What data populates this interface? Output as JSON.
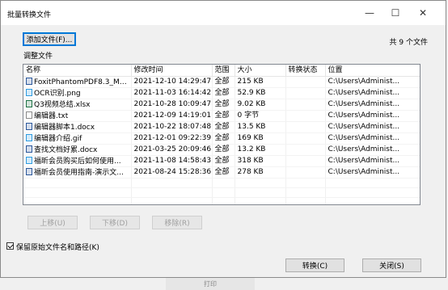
{
  "window": {
    "title": "批量转换文件",
    "minimize": "—",
    "maximize": "☐",
    "close": "✕"
  },
  "toolbar": {
    "add_file": "添加文件(F)...",
    "file_count": "共 9 个文件"
  },
  "list": {
    "group_label": "调整文件",
    "columns": [
      "名称",
      "修改时间",
      "范围",
      "大小",
      "转换状态",
      "位置"
    ],
    "rows": [
      {
        "icon": "pdf-icon",
        "icon_color": "#2b579a",
        "name": "FoxitPhantomPDF8.3_Ma...",
        "modified": "2021-12-10 14:29:47",
        "range": "全部",
        "size": "215 KB",
        "status": "",
        "location": "C:\\Users\\Administ..."
      },
      {
        "icon": "image-icon",
        "icon_color": "#2e9be0",
        "name": "OCR识别.png",
        "modified": "2021-11-03 16:14:42",
        "range": "全部",
        "size": "52.9 KB",
        "status": "",
        "location": "C:\\Users\\Administ..."
      },
      {
        "icon": "excel-icon",
        "icon_color": "#1e7145",
        "name": "Q3视频总结.xlsx",
        "modified": "2021-10-28 10:09:47",
        "range": "全部",
        "size": "9.02 KB",
        "status": "",
        "location": "C:\\Users\\Administ..."
      },
      {
        "icon": "text-file-icon",
        "icon_color": "#888888",
        "name": "编辑器.txt",
        "modified": "2021-12-09 14:19:01",
        "range": "全部",
        "size": "0 字节",
        "status": "",
        "location": "C:\\Users\\Administ..."
      },
      {
        "icon": "word-icon",
        "icon_color": "#2b579a",
        "name": "编辑器脚本1.docx",
        "modified": "2021-10-22 18:07:48",
        "range": "全部",
        "size": "13.5 KB",
        "status": "",
        "location": "C:\\Users\\Administ..."
      },
      {
        "icon": "image-icon",
        "icon_color": "#2e9be0",
        "name": "编辑器介绍.gif",
        "modified": "2021-12-01 09:22:39",
        "range": "全部",
        "size": "169 KB",
        "status": "",
        "location": "C:\\Users\\Administ..."
      },
      {
        "icon": "word-icon",
        "icon_color": "#2b579a",
        "name": "查找文档好累.docx",
        "modified": "2021-03-25 20:09:46",
        "range": "全部",
        "size": "13.2 KB",
        "status": "",
        "location": "C:\\Users\\Administ..."
      },
      {
        "icon": "image-icon",
        "icon_color": "#2e9be0",
        "name": "福昕会员购买后如何使用...",
        "modified": "2021-11-08 14:58:43",
        "range": "全部",
        "size": "318 KB",
        "status": "",
        "location": "C:\\Users\\Administ..."
      },
      {
        "icon": "word-icon",
        "icon_color": "#2b579a",
        "name": "福昕会员使用指南-演示文...",
        "modified": "2021-08-24 15:28:36",
        "range": "全部",
        "size": "278 KB",
        "status": "",
        "location": "C:\\Users\\Administ..."
      }
    ]
  },
  "actions": {
    "move_up": "上移(U)",
    "move_down": "下移(D)",
    "remove": "移除(R)"
  },
  "options": {
    "keep_path_label": "保留原始文件名和路径(K)",
    "keep_path_checked": true
  },
  "footer": {
    "convert": "转换(C)",
    "close": "关闭(S)"
  },
  "background": {
    "print_label": "打印"
  }
}
